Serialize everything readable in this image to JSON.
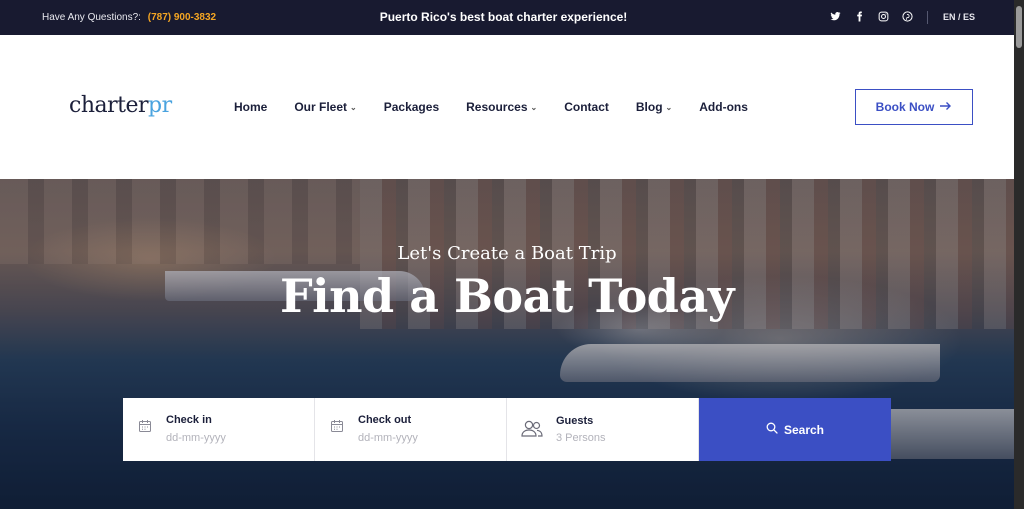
{
  "topbar": {
    "question": "Have Any Questions?:",
    "phone": "(787) 900-3832",
    "tagline": "Puerto Rico's best boat charter experience!",
    "social": [
      "twitter-icon",
      "facebook-icon",
      "instagram-icon",
      "pinterest-icon"
    ],
    "lang": "EN / ES"
  },
  "header": {
    "logo_main": "charter",
    "logo_accent": "pr",
    "nav": [
      {
        "label": "Home",
        "dropdown": false
      },
      {
        "label": "Our Fleet",
        "dropdown": true
      },
      {
        "label": "Packages",
        "dropdown": false
      },
      {
        "label": "Resources",
        "dropdown": true
      },
      {
        "label": "Contact",
        "dropdown": false
      },
      {
        "label": "Blog",
        "dropdown": true
      },
      {
        "label": "Add-ons",
        "dropdown": false
      }
    ],
    "book_label": "Book Now",
    "book_icon": "arrow-right-icon"
  },
  "hero": {
    "subtitle": "Let's Create a Boat Trip",
    "title": "Find a Boat Today"
  },
  "search": {
    "checkin_label": "Check in",
    "checkin_placeholder": "dd-mm-yyyy",
    "checkout_label": "Check out",
    "checkout_placeholder": "dd-mm-yyyy",
    "guests_label": "Guests",
    "guests_value": "3  Persons",
    "button_label": "Search"
  },
  "colors": {
    "topbar": "#181a30",
    "accent": "#3b4fc4",
    "phone": "#f5a623",
    "logo_accent": "#4aa3df"
  }
}
